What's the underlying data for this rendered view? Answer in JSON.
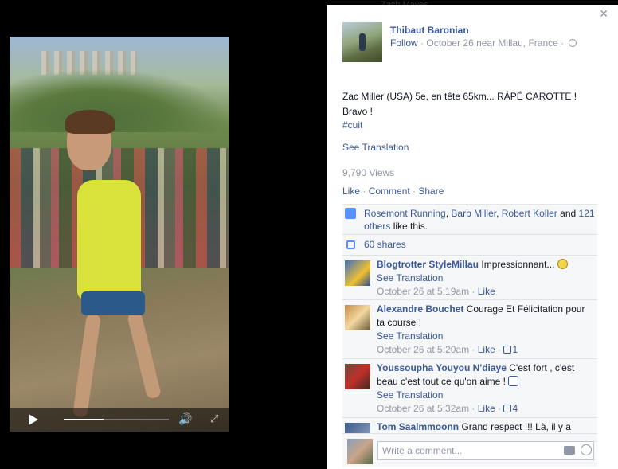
{
  "header_faded": "Zach   Mayes",
  "post": {
    "author": "Thibaut Baronian",
    "follow_label": "Follow",
    "date_location": "October 26 near Millau, France",
    "text_line1": "Zac Miller (USA) 5e, en tête 65km... RÂPÉ CAROTTE !",
    "text_line2": "Bravo !",
    "hashtag": "#cuit",
    "see_translation": "See Translation",
    "views": "9,790 Views",
    "actions": {
      "like": "Like",
      "comment": "Comment",
      "share": "Share"
    }
  },
  "video": {
    "progress": 0.38
  },
  "likes": {
    "names": [
      "Rosemont Running",
      "Barb Miller",
      "Robert Koller"
    ],
    "and": "and",
    "others": "121 others",
    "suffix": "like this."
  },
  "shares": "60 shares",
  "comments": [
    {
      "name": "Blogtrotter StyleMillau",
      "text": "Impressionnant...",
      "translate": "See Translation",
      "time": "October 26 at 5:19am",
      "like": "Like",
      "likes": ""
    },
    {
      "name": "Alexandre Bouchet",
      "text": "Courage Et Félicitation pour ta course !",
      "translate": "See Translation",
      "time": "October 26 at 5:20am",
      "like": "Like",
      "likes": "1"
    },
    {
      "name": "Youssoupha Youyou N'diaye",
      "text": "C'est fort , c'est beau c'est tout ce qu'on aime !",
      "translate": "See Translation",
      "time": "October 26 at 5:32am",
      "like": "Like",
      "likes": "4"
    },
    {
      "name": "Tom Saalmmoonn",
      "text": "Grand respect !!! Là, il y a"
    }
  ],
  "composer": {
    "placeholder": "Write a comment..."
  },
  "colors": {
    "link": "#3b5998",
    "muted": "#9197a3",
    "feedback_bg": "#f6f7f8"
  },
  "icons": [
    "close-icon",
    "globe-icon",
    "play-icon",
    "volume-icon",
    "fullscreen-icon",
    "thumb-up-icon",
    "share-icon",
    "camera-icon",
    "emoji-icon"
  ]
}
